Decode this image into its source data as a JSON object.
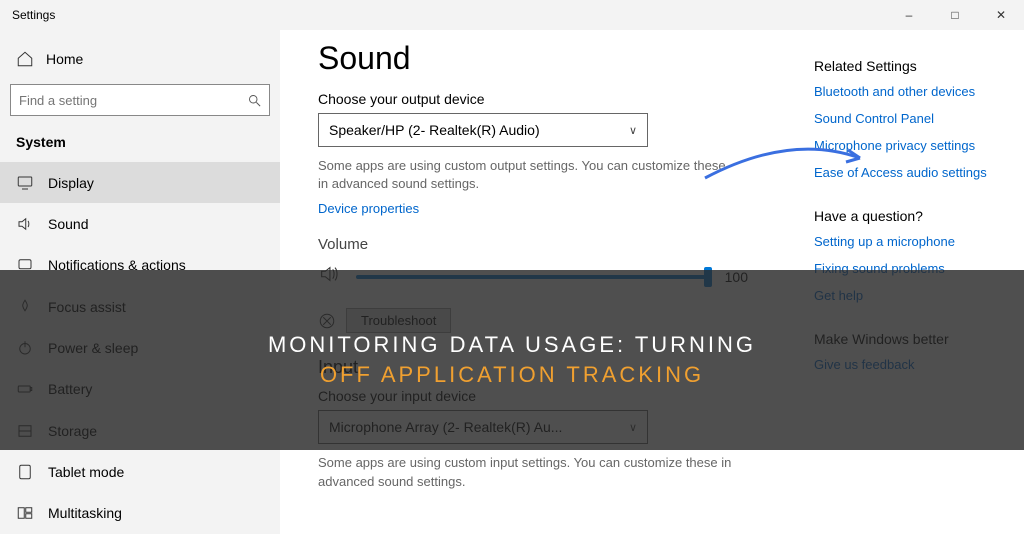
{
  "window": {
    "title": "Settings"
  },
  "sidebar": {
    "home": "Home",
    "search_placeholder": "Find a setting",
    "group": "System",
    "items": [
      {
        "label": "Display",
        "icon": "display"
      },
      {
        "label": "Sound",
        "icon": "sound",
        "selected": false
      },
      {
        "label": "Notifications & actions",
        "icon": "notif"
      },
      {
        "label": "Focus assist",
        "icon": "focus"
      },
      {
        "label": "Power & sleep",
        "icon": "power"
      },
      {
        "label": "Battery",
        "icon": "battery"
      },
      {
        "label": "Storage",
        "icon": "storage"
      },
      {
        "label": "Tablet mode",
        "icon": "tablet"
      },
      {
        "label": "Multitasking",
        "icon": "multitask"
      }
    ]
  },
  "page": {
    "title": "Sound",
    "output": {
      "label": "Choose your output device",
      "value": "Speaker/HP (2- Realtek(R) Audio)",
      "hint": "Some apps are using custom output settings. You can customize these in advanced sound settings.",
      "link": "Device properties"
    },
    "volume": {
      "label": "Volume",
      "value": "100"
    },
    "troubleshoot": {
      "button": "Troubleshoot"
    },
    "input_head": "Input",
    "input": {
      "label": "Choose your input device",
      "value": "Microphone Array (2- Realtek(R) Au...",
      "hint": "Some apps are using custom input settings. You can customize these in advanced sound settings."
    }
  },
  "related": {
    "head": "Related Settings",
    "links": [
      "Bluetooth and other devices",
      "Sound Control Panel",
      "Microphone privacy settings",
      "Ease of Access audio settings"
    ]
  },
  "question": {
    "head": "Have a question?",
    "links": [
      "Setting up a microphone",
      "Fixing sound problems",
      "Get help"
    ]
  },
  "feedback": {
    "head": "Make Windows better",
    "links": [
      "Give us feedback"
    ]
  },
  "overlay": {
    "line1": "MONITORING DATA USAGE: TURNING",
    "line2": "OFF APPLICATION TRACKING"
  }
}
